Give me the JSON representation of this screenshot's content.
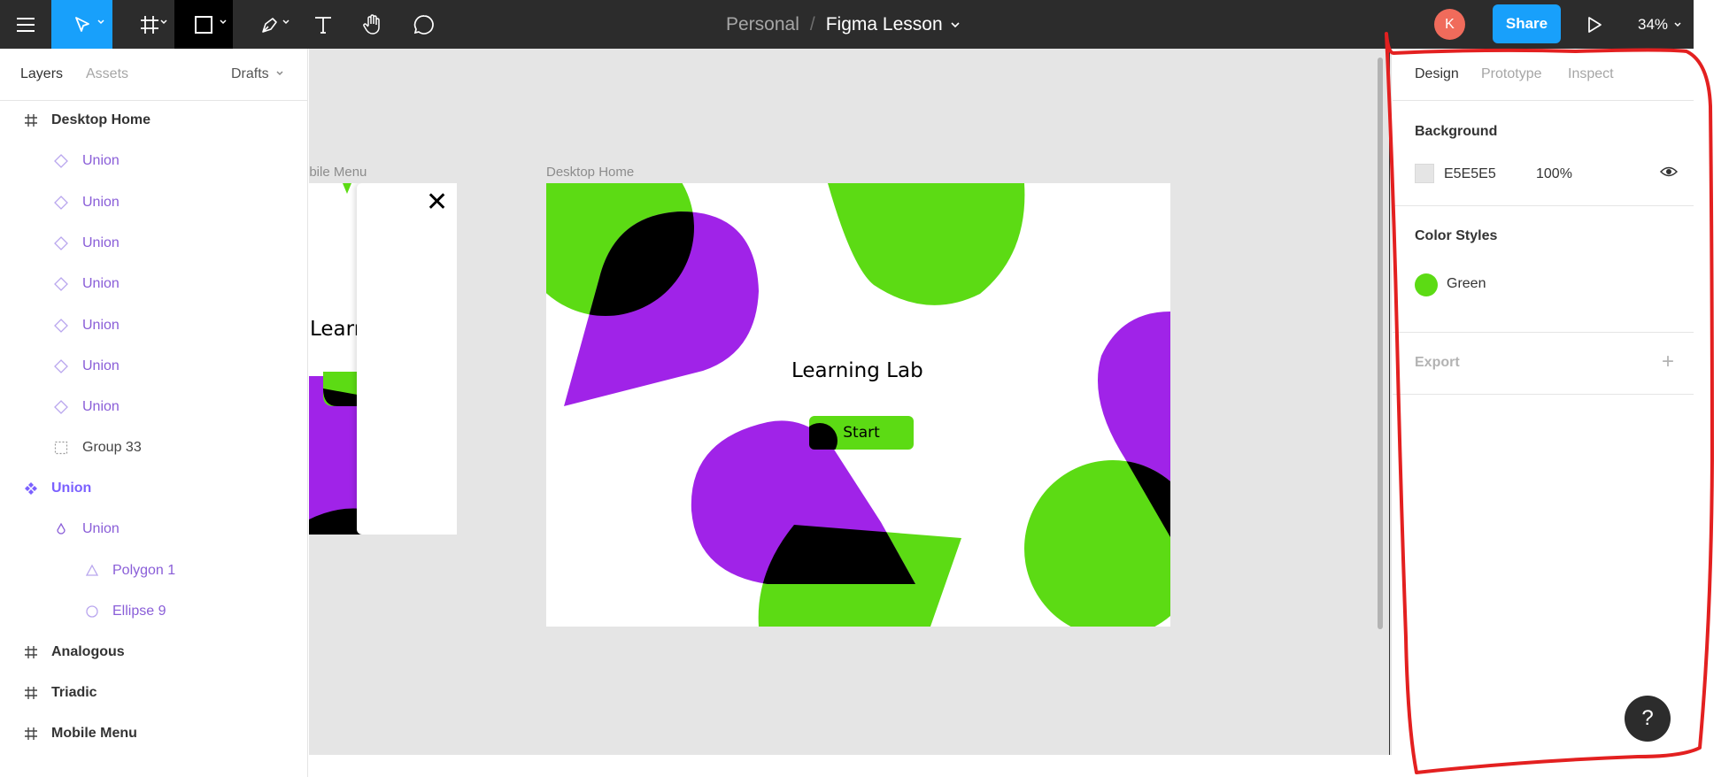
{
  "toolbar": {
    "tools": [
      "menu-icon",
      "move-tool-icon",
      "frame-tool-icon",
      "rectangle-tool-icon",
      "pen-tool-icon",
      "text-tool-icon",
      "hand-tool-icon",
      "comment-tool-icon"
    ],
    "project": "Personal",
    "separator": "/",
    "file_name": "Figma Lesson",
    "avatar_initial": "K",
    "share_label": "Share",
    "zoom": "34%",
    "active_tool_color": "#18a0fb",
    "bg_color": "#2c2c2c"
  },
  "left_panel": {
    "tabs": {
      "layers": "Layers",
      "assets": "Assets"
    },
    "page_select": "Drafts",
    "layers": [
      {
        "label": "Desktop Home",
        "icon": "frame-icon"
      },
      {
        "label": "Union",
        "icon": "union-icon"
      },
      {
        "label": "Union",
        "icon": "union-icon"
      },
      {
        "label": "Union",
        "icon": "union-icon"
      },
      {
        "label": "Union",
        "icon": "union-icon"
      },
      {
        "label": "Union",
        "icon": "union-icon"
      },
      {
        "label": "Union",
        "icon": "union-icon"
      },
      {
        "label": "Union",
        "icon": "union-icon"
      },
      {
        "label": "Group 33",
        "icon": "group-icon"
      },
      {
        "label": "Union",
        "icon": "component-icon"
      },
      {
        "label": "Union",
        "icon": "union-droplet-icon"
      },
      {
        "label": "Polygon 1",
        "icon": "polygon-icon"
      },
      {
        "label": "Ellipse 9",
        "icon": "ellipse-icon"
      },
      {
        "label": "Analogous",
        "icon": "frame-icon"
      },
      {
        "label": "Triadic",
        "icon": "frame-icon"
      },
      {
        "label": "Mobile Menu",
        "icon": "frame-icon"
      }
    ]
  },
  "canvas": {
    "bg_color": "#e5e5e5",
    "mobile_frame_label": "obile Menu",
    "desktop_frame_label": "Desktop Home",
    "mobile_partial_text": "Learr",
    "close_glyph": "✕",
    "desktop_title": "Learning Lab",
    "start_button": "Start",
    "colors": {
      "green": "#5cdb14",
      "purple": "#a023e8",
      "black": "#000000"
    }
  },
  "right_panel": {
    "tabs": {
      "design": "Design",
      "prototype": "Prototype",
      "inspect": "Inspect"
    },
    "background": {
      "title": "Background",
      "hex": "E5E5E5",
      "opacity": "100%"
    },
    "color_styles": {
      "title": "Color Styles",
      "items": [
        {
          "name": "Green",
          "color": "#5cdb14"
        }
      ]
    },
    "export": {
      "title": "Export",
      "add_icon": "plus-icon"
    },
    "help": "?",
    "annotation_color": "#e32020"
  }
}
